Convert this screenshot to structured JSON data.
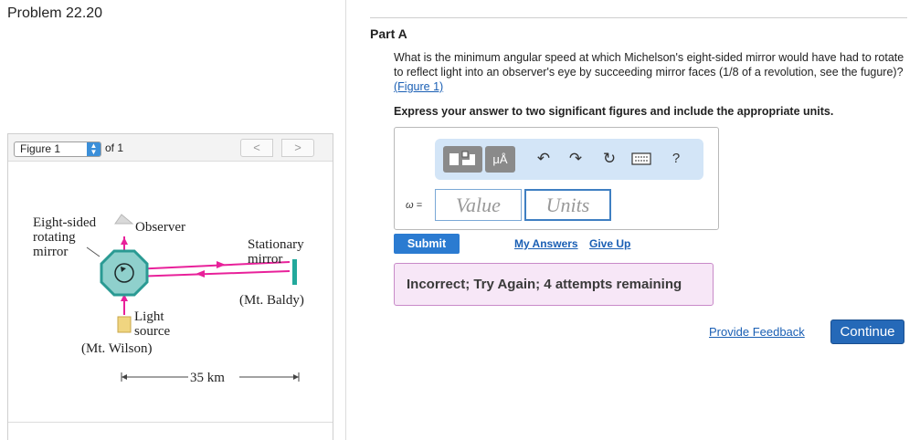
{
  "problem_title": "Problem 22.20",
  "figure_panel": {
    "select_value": "Figure 1",
    "of_text": "of 1",
    "prev_glyph": "<",
    "next_glyph": ">",
    "labels": {
      "mirror_line1": "Eight-sided",
      "mirror_line2": "rotating",
      "mirror_line3": "mirror",
      "observer": "Observer",
      "stationary_line1": "Stationary",
      "stationary_line2": "mirror",
      "mt_baldy": "(Mt. Baldy)",
      "light_line1": "Light",
      "light_line2": "source",
      "mt_wilson": "(Mt. Wilson)",
      "distance": "35 km"
    },
    "colors": {
      "beam": "#e8219a",
      "octagon_fill": "#8fd0cc",
      "octagon_stroke": "#2a9a93",
      "stationary_mirror": "#22a99c",
      "observer": "#d9d9d9",
      "light_source": "#f0d580"
    }
  },
  "part": {
    "label": "Part A",
    "question_text": "What is the minimum angular speed at which Michelson's eight-sided mirror would have had to rotate to reflect light into an observer's eye by succeeding mirror faces (1/8 of a revolution, see the fugure)?",
    "question_link": "(Figure 1)",
    "instruction": "Express your answer to two significant figures and include the appropriate units."
  },
  "toolbar": {
    "template_icon": "template-icon",
    "units_button_label": "μÅ",
    "undo_icon": "undo-icon",
    "redo_icon": "redo-icon",
    "reset_icon": "reset-icon",
    "keyboard_icon": "keyboard-icon",
    "help_label": "?"
  },
  "answer": {
    "variable_label": "ω =",
    "value_placeholder": "Value",
    "units_placeholder": "Units"
  },
  "actions": {
    "submit_label": "Submit",
    "my_answers_label": "My Answers",
    "give_up_label": "Give Up"
  },
  "feedback": {
    "message": "Incorrect; Try Again; 4 attempts remaining"
  },
  "footer": {
    "provide_feedback_label": "Provide Feedback",
    "continue_label": "Continue"
  },
  "colors": {
    "accent": "#2b7bd1",
    "continue": "#2569b8",
    "feedback_bg": "#f7e7f7",
    "feedback_border": "#c88ac8"
  }
}
